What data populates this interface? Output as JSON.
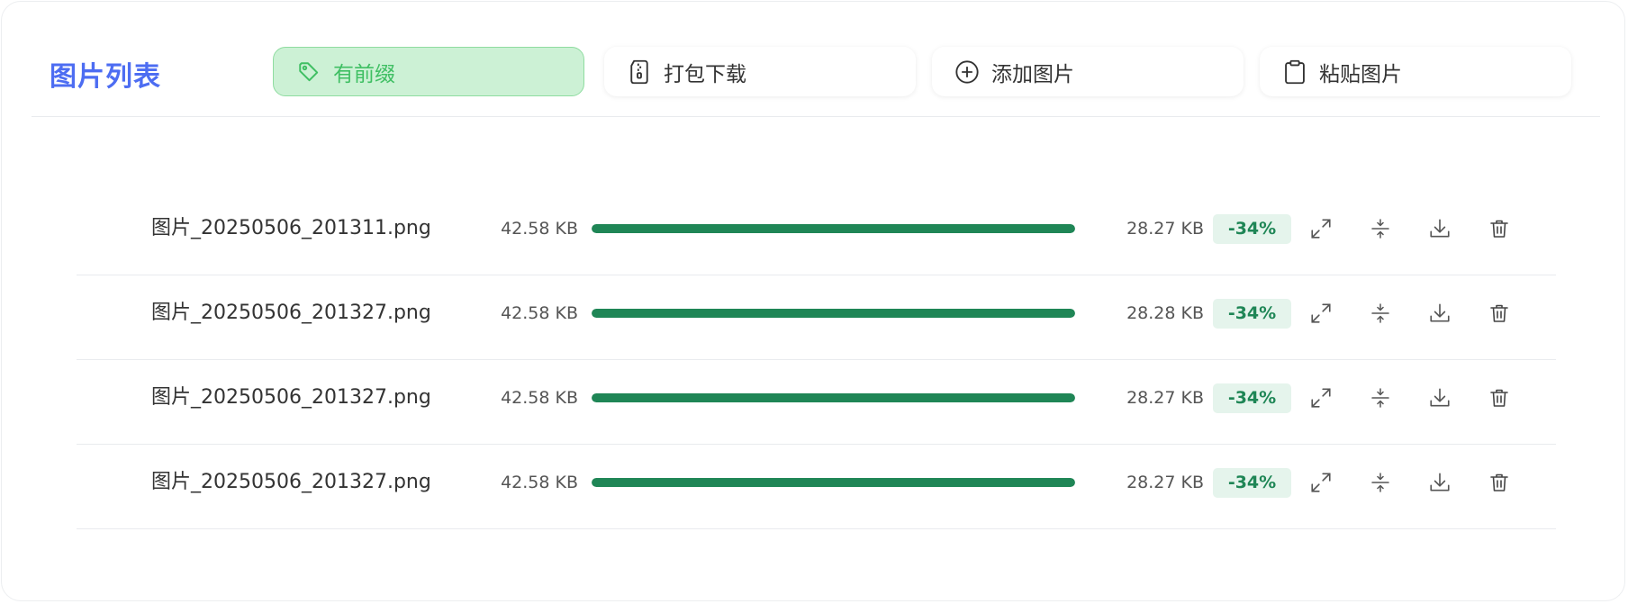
{
  "header": {
    "title": "图片列表",
    "buttons": [
      {
        "label": "有前缀",
        "icon": "tag-icon",
        "active": true
      },
      {
        "label": "打包下载",
        "icon": "zip-file-icon",
        "active": false
      },
      {
        "label": "添加图片",
        "icon": "plus-circle-icon",
        "active": false
      },
      {
        "label": "粘贴图片",
        "icon": "clipboard-icon",
        "active": false
      }
    ]
  },
  "colors": {
    "title": "#4d6df2",
    "active_bg": "#ccf1d5",
    "active_text": "#3fbf63",
    "progress": "#1f8656",
    "badge_bg": "#e5f4ec"
  },
  "files": [
    {
      "name": "图片_20250506_201311.png",
      "original_size": "42.58 KB",
      "compressed_size": "28.27 KB",
      "reduction": "-34%",
      "progress": 1.0
    },
    {
      "name": "图片_20250506_201327.png",
      "original_size": "42.58 KB",
      "compressed_size": "28.28 KB",
      "reduction": "-34%",
      "progress": 1.0
    },
    {
      "name": "图片_20250506_201327.png",
      "original_size": "42.58 KB",
      "compressed_size": "28.27 KB",
      "reduction": "-34%",
      "progress": 1.0
    },
    {
      "name": "图片_20250506_201327.png",
      "original_size": "42.58 KB",
      "compressed_size": "28.27 KB",
      "reduction": "-34%",
      "progress": 1.0
    }
  ],
  "row_actions": [
    "expand-icon",
    "compress-icon",
    "download-icon",
    "trash-icon"
  ]
}
